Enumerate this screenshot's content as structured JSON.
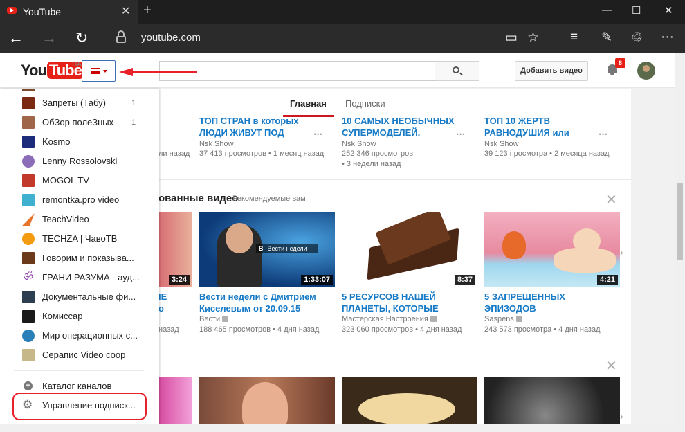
{
  "browser": {
    "tab_title": "YouTube",
    "new_tab": "+",
    "close_tab": "✕",
    "window_min": "—",
    "window_max": "☐",
    "window_close": "✕",
    "back": "←",
    "forward": "→",
    "refresh": "↻",
    "url": "youtube.com",
    "reading_view": "▭",
    "favorite": "☆",
    "hub": "≡",
    "note": "✎",
    "share": "♲",
    "more": "···"
  },
  "header": {
    "logo_you": "You",
    "logo_tube": "Tube",
    "region": "UA",
    "upload_label": "Добавить видео",
    "notif_count": "8"
  },
  "tabs": [
    {
      "label": "Главная"
    },
    {
      "label": "Подписки"
    }
  ],
  "top_videos": [
    {
      "title_1": "ТОП СТРАН в которых",
      "title_2": "ЛЮДИ ЖИВУТ ПОД",
      "channel": "Nsk Show",
      "meta": "37 413 просмотров • 1 месяц назад",
      "meta2": ""
    },
    {
      "title_1": "10 САМЫХ НЕОБЫЧНЫХ",
      "title_2": "СУПЕРМОДЕЛЕЙ.",
      "channel": "Nsk Show",
      "meta": "252 346 просмотров",
      "meta2": "• 3 недели назад"
    },
    {
      "title_1": "ТОП 10 ЖЕРТВ",
      "title_2": "РАВНОДУШИЯ или",
      "channel": "Nsk Show",
      "meta": "39 123 просмотра • 2 месяца назад",
      "meta2": ""
    }
  ],
  "partial_meta_top": "ли назад",
  "shelf": {
    "title": "ованные видео",
    "subtitle": "Рекомендуемые вам",
    "partial": {
      "duration": "3:24",
      "title_1": "ІЕ",
      "title_2": "о",
      "meta": "назад"
    },
    "videos": [
      {
        "duration": "1:33:07",
        "title_1": "Вести недели с Дмитрием",
        "title_2": "Киселевым от 20.09.15",
        "channel": "Вести",
        "meta": "188 465 просмотров • 4 дня назад",
        "overlay": "Вести недели",
        "overlay_logo": "В"
      },
      {
        "duration": "8:37",
        "title_1": "5 РЕСУРСОВ НАШЕЙ",
        "title_2": "ПЛАНЕТЫ, КОТОРЫЕ",
        "channel": "Мастерская Настроения",
        "meta": "323 060 просмотров • 4 дня назад"
      },
      {
        "duration": "4:21",
        "title_1": "5 ЗАПРЕЩЕННЫХ",
        "title_2": "ЭПИЗОДОВ",
        "channel": "Saspens",
        "meta": "243 573 просмотра • 4 дня назад"
      }
    ]
  },
  "guide": {
    "items": [
      {
        "label": "Запреты (Табу)",
        "count": "1",
        "color": "#7a2a12"
      },
      {
        "label": "ОбЗор полеЗных",
        "count": "1",
        "color": "#a0664a"
      },
      {
        "label": "Kosmo",
        "count": "",
        "color": "#1c2b7a"
      },
      {
        "label": "Lenny Rossolovski",
        "count": "",
        "color": "#8c6bb8"
      },
      {
        "label": "MOGOL TV",
        "count": "",
        "color": "#c0392b"
      },
      {
        "label": "remontka.pro video",
        "count": "",
        "color": "#3fb0d0"
      },
      {
        "label": "TeachVideo",
        "count": "",
        "color": "#e8742a"
      },
      {
        "label": "TECHZA | ЧавоТВ",
        "count": "",
        "color": "#f39c12"
      },
      {
        "label": "Говорим и показыва...",
        "count": "",
        "color": "#6b3a1a"
      },
      {
        "label": "ГРАНИ РАЗУМА - ауд...",
        "count": "",
        "color": "#8e44ad"
      },
      {
        "label": "Документальные фи...",
        "count": "",
        "color": "#2c3e50"
      },
      {
        "label": "Комиссар",
        "count": "",
        "color": "#1a1a1a"
      },
      {
        "label": "Мир операционных с...",
        "count": "",
        "color": "#2980b9"
      },
      {
        "label": "Серапис Video coop",
        "count": "",
        "color": "#c7b88a"
      }
    ],
    "catalog": "Каталог каналов",
    "manage": "Управление подписк..."
  },
  "colors": {
    "accent": "#cc181e",
    "link": "#167ac6",
    "highlight": "#e8202a"
  }
}
